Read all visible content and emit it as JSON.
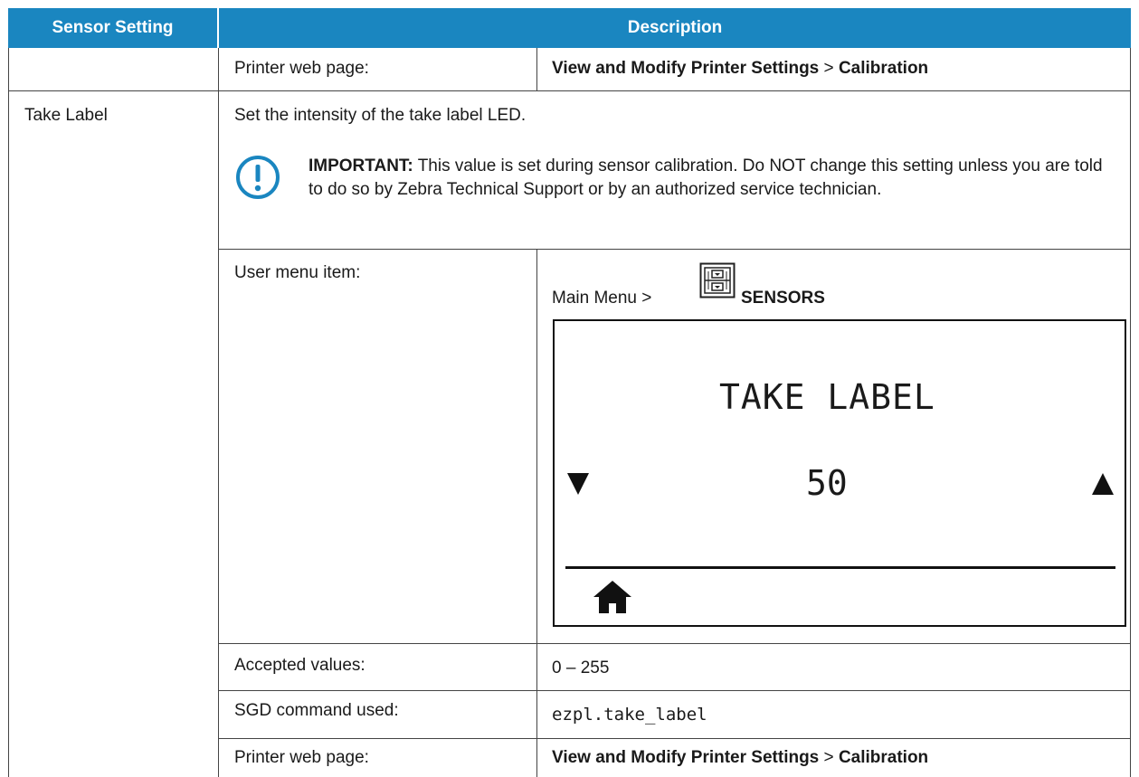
{
  "header": {
    "col1": "Sensor Setting",
    "col2": "Description"
  },
  "top_row": {
    "label": "Printer web page:",
    "path_bold_1": "View and Modify Printer Settings",
    "sep": ">",
    "path_bold_2": "Calibration"
  },
  "setting": {
    "name": "Take Label",
    "description": "Set the intensity of the take label LED.",
    "important_label": "IMPORTANT:",
    "important_text": "This value is set during sensor calibration. Do NOT change this setting unless you are told to do so by Zebra Technical Support or by an authorized service technician.",
    "user_menu_label": "User menu item:",
    "menu_path": "Main Menu >",
    "menu_icon": "sensors-menu-icon",
    "menu_section": "SENSORS",
    "lcd": {
      "title": "TAKE LABEL",
      "value": "50",
      "left_arrow": "▼",
      "right_arrow": "▲",
      "home_icon": "home-icon"
    },
    "accepted_label": "Accepted values:",
    "accepted_value": "0 – 255",
    "sgd_label": "SGD command used:",
    "sgd_value": "ezpl.take_label",
    "web_label": "Printer web page:",
    "web_bold_1": "View and Modify Printer Settings",
    "web_sep": ">",
    "web_bold_2": "Calibration"
  }
}
